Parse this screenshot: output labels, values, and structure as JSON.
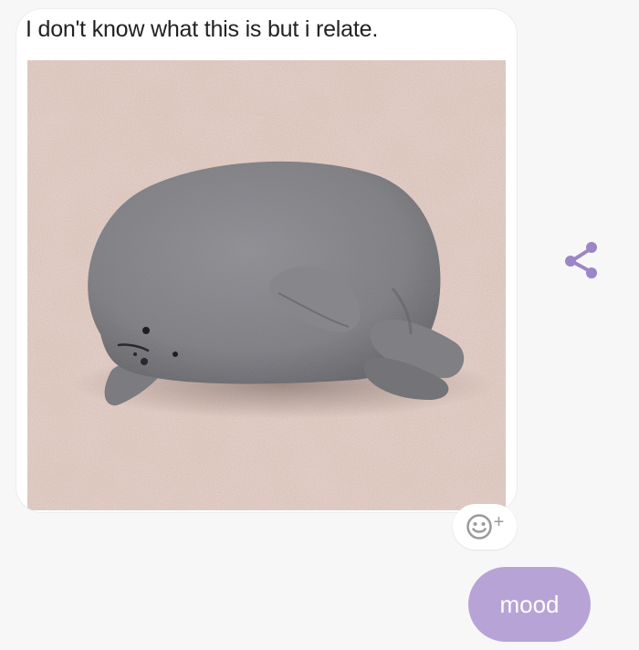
{
  "conversation": {
    "incoming_message": {
      "caption": "I don't know what this is but i relate.",
      "image_alt": "grey clay seal figure lying on a speckled countertop",
      "share_icon": "share-icon",
      "reaction_icon": "add-reaction-icon",
      "reaction_plus": "+"
    },
    "outgoing_message": {
      "text": "mood",
      "color": "#b8a3d6"
    }
  },
  "colors": {
    "accent": "#9b86c7",
    "background": "#f7f7f8"
  }
}
